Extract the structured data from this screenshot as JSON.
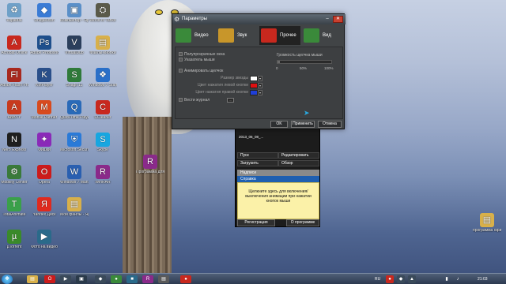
{
  "desktop": {
    "icons": [
      {
        "label": "Корзина",
        "icon": "recycle-bin-icon",
        "color": "#6fa0c8",
        "glyph": "♻"
      },
      {
        "label": "UniqueIcon",
        "icon": "app-icon",
        "color": "#3a7bd5",
        "glyph": "◆"
      },
      {
        "label": "Компьютер - Ярлык",
        "icon": "computer-icon",
        "color": "#5a8fc8",
        "glyph": "▣"
      },
      {
        "label": "World of Tanks",
        "icon": "tank-icon",
        "color": "#5a5a4a",
        "glyph": "⛭"
      },
      {
        "label": "Acrobat Online",
        "icon": "acrobat-icon",
        "color": "#c8281e",
        "glyph": "A"
      },
      {
        "label": "Adobe Photoshop",
        "icon": "photoshop-icon",
        "color": "#1e4f8c",
        "glyph": "Ps"
      },
      {
        "label": "VirtualDub",
        "icon": "virtualdub-icon",
        "color": "#2b3f5c",
        "glyph": "V"
      },
      {
        "label": "Файлы-кнопки",
        "icon": "folder-icon",
        "color": "#d8b04a",
        "glyph": "▤"
      },
      {
        "label": "Adobe Flash Professional",
        "icon": "flash-icon",
        "color": "#a8281e",
        "glyph": "Fl"
      },
      {
        "label": "KMPlayer",
        "icon": "kmplayer-icon",
        "color": "#2a4f8a",
        "glyph": "K"
      },
      {
        "label": "Snagit 11",
        "icon": "snagit-icon",
        "color": "#2f7a3a",
        "glyph": "S"
      },
      {
        "label": "Windows 7 Start Orb",
        "icon": "windows-orb-icon",
        "color": "#2a6fc8",
        "glyph": "❖"
      },
      {
        "label": "ABBYY",
        "icon": "abbyy-icon",
        "color": "#c83a1e",
        "glyph": "A"
      },
      {
        "label": "Mobile Partner",
        "icon": "mobile-icon",
        "color": "#d84a1e",
        "glyph": "M"
      },
      {
        "label": "QuickTime Player",
        "icon": "quicktime-icon",
        "color": "#2a6ab8",
        "glyph": "Q"
      },
      {
        "label": "CCleaner",
        "icon": "ccleaner-icon",
        "color": "#c8281e",
        "glyph": "C"
      },
      {
        "label": "Nero Express",
        "icon": "nero-icon",
        "color": "#1e1e1e",
        "glyph": "N"
      },
      {
        "label": "Фишки",
        "icon": "app-icon",
        "color": "#8a2ab8",
        "glyph": "✦"
      },
      {
        "label": "Microsoft Security",
        "icon": "security-icon",
        "color": "#2a7ad8",
        "glyph": "⛨"
      },
      {
        "label": "Skype",
        "icon": "skype-icon",
        "color": "#18a6e0",
        "glyph": "S"
      },
      {
        "label": "Mobility Center",
        "icon": "mobility-icon",
        "color": "#3a7a3a",
        "glyph": "⚙"
      },
      {
        "label": "Opera",
        "icon": "opera-icon",
        "color": "#cc1b1b",
        "glyph": "O"
      },
      {
        "label": "Windows 7 Manager",
        "icon": "win7-manager-icon",
        "color": "#2a5fb0",
        "glyph": "W"
      },
      {
        "label": "WinRAR",
        "icon": "winrar-icon",
        "color": "#8a2a8a",
        "glyph": "R"
      },
      {
        "label": "TotalAnimate",
        "icon": "animate-icon",
        "color": "#3aa04a",
        "glyph": "T"
      },
      {
        "label": "Yandex Диск",
        "icon": "yandex-icon",
        "color": "#e02a1e",
        "glyph": "Я"
      },
      {
        "label": "Мои файлы - Ярлык",
        "icon": "folder-icon",
        "color": "#d8b04a",
        "glyph": "▤"
      },
      {
        "label": "WinRAR Links",
        "icon": "winrar-icon",
        "color": "#8a2a8a",
        "glyph": "R"
      },
      {
        "label": "µTorrent",
        "icon": "utorrent-icon",
        "color": "#3a8a2a",
        "glyph": "µ"
      },
      {
        "label": "Фото на видео",
        "icon": "video-icon",
        "color": "#2a6a8a",
        "glyph": "▶"
      }
    ],
    "program_shortcut": {
      "label": "Программа для записи...",
      "icon": "winrar-icon",
      "color": "#8a2a8a",
      "glyph": "R"
    },
    "right_folder": {
      "label": "программа офисный...",
      "icon": "folder-icon",
      "color": "#d8b04a",
      "glyph": "▤"
    }
  },
  "program": {
    "file": "2013_06_08_...",
    "start": "Пуск",
    "edit": "Редактировать",
    "load": "Загрузить",
    "browse": "Обзор",
    "labels": "Надписи",
    "help": "Справка",
    "panel_text": "Щелкните здесь для включения/выключения анимации при нажатии кнопок мыши",
    "register": "Регистрация",
    "about": "О программе"
  },
  "dialog": {
    "title": "Параметры",
    "tabs": [
      {
        "label": "Видео",
        "icon": "video-tab-icon",
        "color": "#3a8a3a"
      },
      {
        "label": "Звук",
        "icon": "sound-tab-icon",
        "color": "#c8962a"
      },
      {
        "label": "Прочее",
        "icon": "other-tab-icon",
        "color": "#c8281e"
      },
      {
        "label": "Вид",
        "icon": "view-tab-icon",
        "color": "#3a8a3a"
      }
    ],
    "options": {
      "semi_transparent": "Полупрозрачные окна",
      "show_mouse": "Указатель мыши",
      "animate_clicks": "Анимировать щелчок",
      "star_size": "Размер звезды",
      "left_color": "Цвет нажатия левой кнопки",
      "right_color": "Цвет нажатия правой кнопки",
      "log": "Вести журнал"
    },
    "colors": {
      "star": "#ffffff",
      "left": "#e01010",
      "right": "#1f3fd8"
    },
    "volume": {
      "label": "Громкость щелчка мыши",
      "ticks": [
        "0",
        "50%",
        "100%"
      ],
      "level": 0.05
    },
    "buttons": {
      "ok": "OK",
      "apply": "Применить",
      "cancel": "Отмена"
    }
  },
  "taskbar": {
    "language": "RU",
    "time": "21:03"
  }
}
